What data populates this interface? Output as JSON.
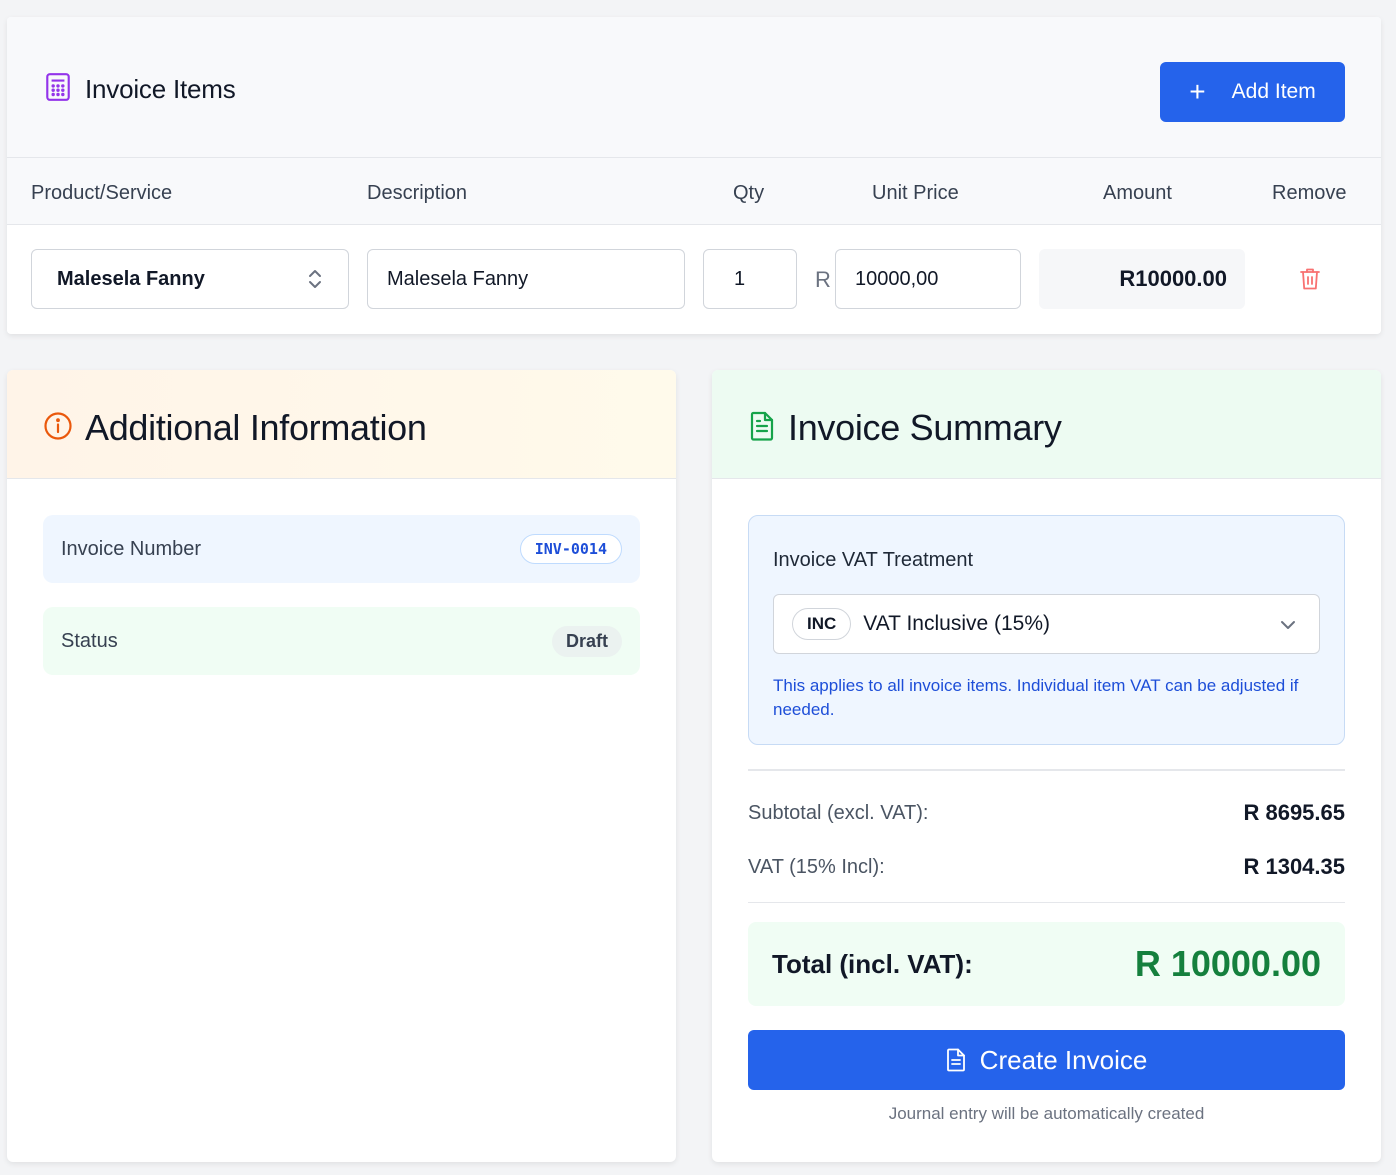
{
  "items": {
    "title": "Invoice Items",
    "add_label": "Add Item",
    "columns": {
      "product": "Product/Service",
      "description": "Description",
      "qty": "Qty",
      "unit_price": "Unit Price",
      "amount": "Amount",
      "remove": "Remove"
    },
    "rows": [
      {
        "product": "Malesela Fanny",
        "description": "Malesela Fanny",
        "qty": "1",
        "currency_prefix": "R",
        "unit_price": "10000,00",
        "amount": "R10000.00"
      }
    ]
  },
  "additional": {
    "title": "Additional Information",
    "invoice_number_label": "Invoice Number",
    "invoice_number": "INV-0014",
    "status_label": "Status",
    "status": "Draft"
  },
  "summary": {
    "title": "Invoice Summary",
    "vat_treatment_label": "Invoice VAT Treatment",
    "vat_badge": "INC",
    "vat_selected": "VAT Inclusive (15%)",
    "vat_note": "This applies to all invoice items. Individual item VAT can be adjusted if needed.",
    "subtotal_label": "Subtotal (excl. VAT):",
    "subtotal_value": "R 8695.65",
    "vat_label": "VAT (15% Incl):",
    "vat_value": "R 1304.35",
    "total_label": "Total (incl. VAT):",
    "total_value": "R 10000.00",
    "create_label": "Create Invoice",
    "footnote": "Journal entry will be automatically created"
  },
  "colors": {
    "primary": "#2563eb",
    "total_green": "#15803d",
    "trash_red": "#f87171",
    "info_orange": "#ea580c",
    "summary_green": "#16a34a",
    "calc_purple": "#9333ea"
  },
  "icons": [
    "calculator-icon",
    "plus-icon",
    "up-down-chevron-icon",
    "trash-icon",
    "info-circle-icon",
    "file-text-icon",
    "chevron-down-icon",
    "file-icon"
  ]
}
